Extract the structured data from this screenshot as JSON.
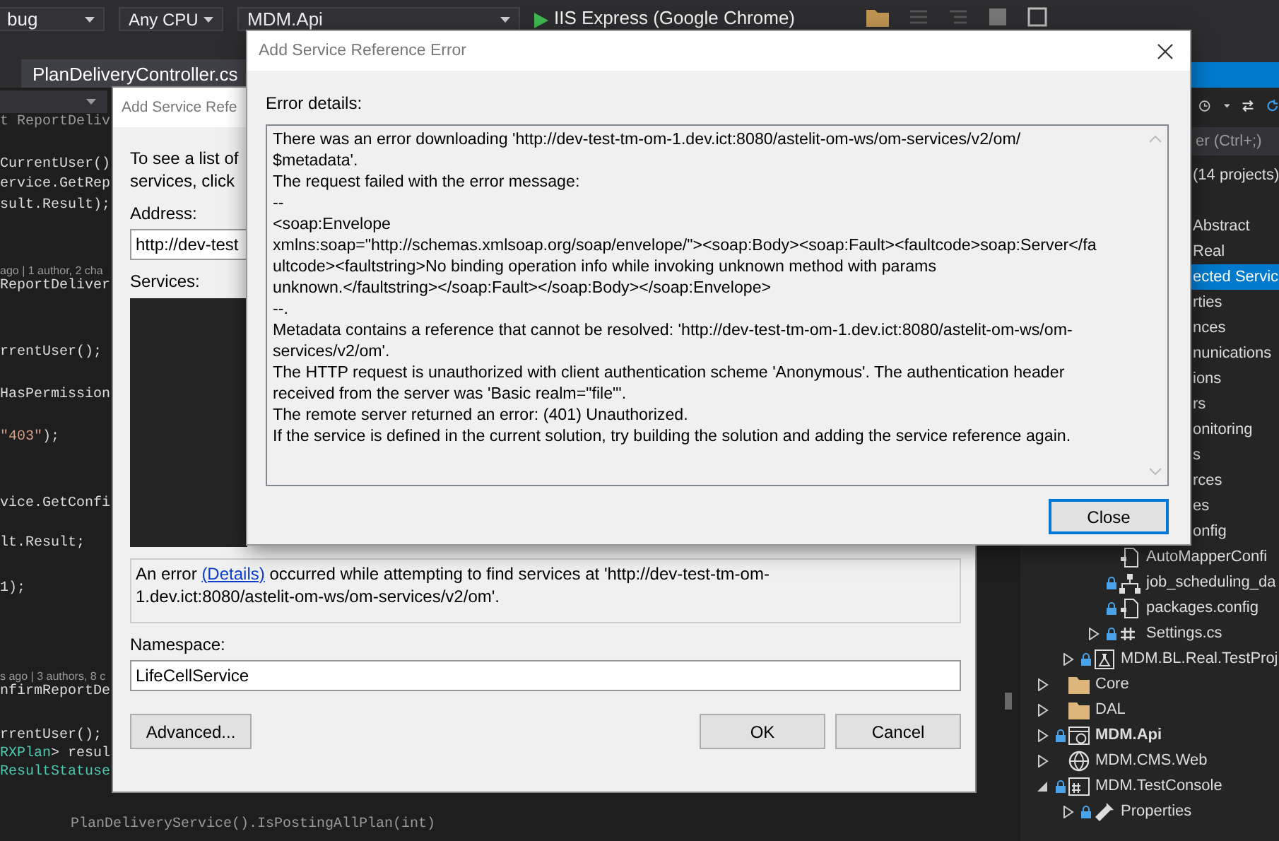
{
  "toolbar": {
    "combos": [
      {
        "text": "bug"
      },
      {
        "text": "Any CPU"
      },
      {
        "text": "MDM.Api"
      }
    ],
    "run_target": "IIS Express (Google Chrome)"
  },
  "editor_tab": {
    "label": "PlanDeliveryController.cs",
    "selected": true
  },
  "code_lines": [
    {
      "kind": "code",
      "parts": [
        {
          "text": "t ReportDeliv",
          "kind": "dim"
        }
      ]
    },
    {
      "kind": "code",
      "parts": [
        {
          "text": "CurrentUser()",
          "kind": "plain"
        }
      ]
    },
    {
      "kind": "code",
      "parts": [
        {
          "text": "ervice.GetRep",
          "kind": "plain"
        }
      ]
    },
    {
      "kind": "code",
      "parts": [
        {
          "text": "sult.Result);",
          "kind": "plain"
        }
      ]
    },
    {
      "kind": "lens",
      "parts": [
        {
          "text": "ago | 1 author, 2 cha",
          "kind": "plain"
        }
      ]
    },
    {
      "kind": "code",
      "parts": [
        {
          "text": "ReportDeliver",
          "kind": "plain"
        }
      ]
    },
    {
      "kind": "code",
      "parts": [
        {
          "text": "rrentUser();",
          "kind": "plain"
        }
      ]
    },
    {
      "kind": "code",
      "parts": [
        {
          "text": "HasPermission",
          "kind": "plain"
        }
      ]
    },
    {
      "kind": "code",
      "parts": [
        {
          "text": "\"403\"",
          "kind": "string"
        },
        {
          "text": ");",
          "kind": "plain"
        }
      ]
    },
    {
      "kind": "code",
      "parts": [
        {
          "text": "vice.GetConfi",
          "kind": "plain"
        }
      ]
    },
    {
      "kind": "code",
      "parts": [
        {
          "text": "lt.Result;",
          "kind": "plain"
        }
      ]
    },
    {
      "kind": "code",
      "parts": [
        {
          "text": "1);",
          "kind": "plain"
        }
      ]
    },
    {
      "kind": "lens",
      "parts": [
        {
          "text": "s ago | 3 authors, 8 c",
          "kind": "plain"
        }
      ]
    },
    {
      "kind": "code",
      "parts": [
        {
          "text": "nfirmReportDe",
          "kind": "plain"
        }
      ]
    },
    {
      "kind": "code",
      "parts": [
        {
          "text": "rrentUser();",
          "kind": "plain"
        }
      ]
    },
    {
      "kind": "code",
      "parts": [
        {
          "text": "RXPlan",
          "kind": "type"
        },
        {
          "text": "> resul",
          "kind": "plain"
        }
      ]
    },
    {
      "kind": "code",
      "parts": [
        {
          "text": "ResultStatuse",
          "kind": "type"
        }
      ]
    },
    {
      "kind": "hint",
      "parts": [
        {
          "text": "PlanDeliveryService().IsPostingAllPlan(int)",
          "kind": "dim"
        }
      ]
    }
  ],
  "reference_dialog": {
    "title": "Add Service Refe",
    "intro": [
      "To see a list of",
      "services, click"
    ],
    "address_label": "Address:",
    "address_value": "http://dev-test",
    "services_label": "Services:",
    "status": {
      "before": "An error ",
      "link": "(Details)",
      "after": " occurred while attempting to find services at 'http://dev-test-tm-om-\n1.dev.ict:8080/astelit-om-ws/om-services/v2/om'."
    },
    "namespace_label": "Namespace:",
    "namespace_value": "LifeCellService",
    "buttons": [
      {
        "label": "Advanced...",
        "kind": "left"
      },
      {
        "label": "OK",
        "kind": "right"
      },
      {
        "label": "Cancel",
        "kind": "right"
      }
    ]
  },
  "error_dialog": {
    "title": "Add Service Reference Error",
    "details_label": "Error details:",
    "details_lines": [
      "There was an error downloading 'http://dev-test-tm-om-1.dev.ict:8080/astelit-om-ws/om-services/v2/om/",
      "$metadata'.",
      "The request failed with the error message:",
      "--",
      "<soap:Envelope",
      "xmlns:soap=\"http://schemas.xmlsoap.org/soap/envelope/\"><soap:Body><soap:Fault><faultcode>soap:Server</fa",
      "ultcode><faultstring>No binding operation info while invoking unknown method with params",
      "unknown.</faultstring></soap:Fault></soap:Body></soap:Envelope>",
      "--.",
      "Metadata contains a reference that cannot be resolved: 'http://dev-test-tm-om-1.dev.ict:8080/astelit-om-ws/om-",
      "services/v2/om'.",
      "The HTTP request is unauthorized with client authentication scheme 'Anonymous'. The authentication header",
      "received from the server was 'Basic realm=\"file\"'.",
      "The remote server returned an error: (401) Unauthorized.",
      "If the service is defined in the current solution, try building the solution and adding the service reference again."
    ],
    "button": "Close"
  },
  "solution_explorer": {
    "search_placeholder": "er (Ctrl+;)",
    "solution": "(14 projects)",
    "clipped_rows": [
      {
        "label": "Abstract",
        "selected": false
      },
      {
        "label": "Real",
        "selected": false
      },
      {
        "label": "ected Servic",
        "selected": true
      },
      {
        "label": "rties",
        "selected": false
      },
      {
        "label": "nces",
        "selected": false
      },
      {
        "label": "nunications",
        "selected": false
      },
      {
        "label": "ions",
        "selected": false
      },
      {
        "label": "rs",
        "selected": false
      },
      {
        "label": "onitoring",
        "selected": false
      },
      {
        "label": "s",
        "selected": false
      },
      {
        "label": "rces",
        "selected": false
      },
      {
        "label": "es",
        "selected": false
      },
      {
        "label": "onfig",
        "selected": false
      }
    ],
    "project_files": [
      {
        "label": "AutoMapperConfi",
        "kind": "file",
        "locked": false,
        "expandable": false
      },
      {
        "label": "job_scheduling_da",
        "kind": "diagram",
        "locked": true,
        "expandable": false
      },
      {
        "label": "packages.config",
        "kind": "config",
        "locked": true,
        "expandable": false
      },
      {
        "label": "Settings.cs",
        "kind": "csharp",
        "locked": true,
        "expandable": true
      }
    ],
    "nested_project": {
      "label": "MDM.BL.Real.TestProj",
      "kind": "test",
      "locked": true,
      "expanded": false,
      "bold": false
    },
    "items": [
      {
        "label": "Core",
        "kind": "folder",
        "locked": false,
        "expanded": false,
        "bold": false
      },
      {
        "label": "DAL",
        "kind": "folder",
        "locked": false,
        "expanded": false,
        "bold": false
      },
      {
        "label": "MDM.Api",
        "kind": "web",
        "locked": true,
        "expanded": false,
        "bold": true
      },
      {
        "label": "MDM.CMS.Web",
        "kind": "globe",
        "locked": false,
        "expanded": false,
        "bold": false
      },
      {
        "label": "MDM.TestConsole",
        "kind": "console",
        "locked": true,
        "expanded": true,
        "bold": false,
        "children": [
          {
            "label": "Properties",
            "kind": "wrench",
            "locked": true,
            "expanded": false,
            "bold": false
          }
        ]
      }
    ]
  }
}
